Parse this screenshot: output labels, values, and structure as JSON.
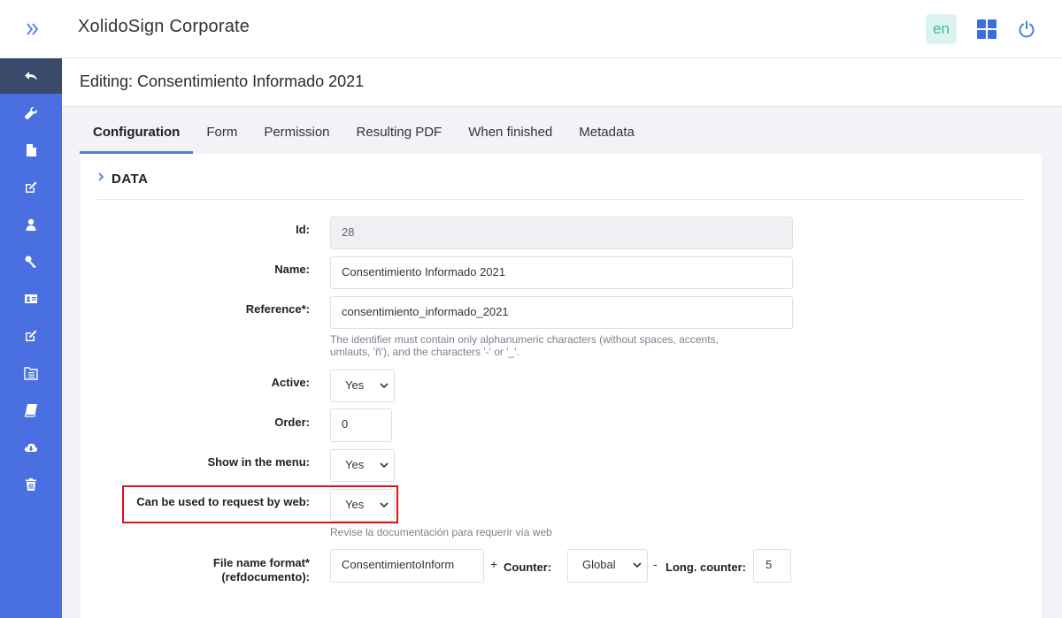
{
  "header": {
    "app_title": "XolidoSign Corporate",
    "lang": "en",
    "expand_icon": "chevron-double-right-icon",
    "apps_icon": "grid-icon",
    "power_icon": "power-icon",
    "accent_color": "#4a6fe0"
  },
  "sidebar": {
    "items": [
      {
        "icon": "back-arrow-icon",
        "active": true
      },
      {
        "icon": "wrench-icon"
      },
      {
        "icon": "document-icon"
      },
      {
        "icon": "edit-icon"
      },
      {
        "icon": "user-icon"
      },
      {
        "icon": "key-icon"
      },
      {
        "icon": "id-card-icon"
      },
      {
        "icon": "edit-alt-icon"
      },
      {
        "icon": "folder-list-icon"
      },
      {
        "icon": "book-icon"
      },
      {
        "icon": "cloud-download-icon"
      },
      {
        "icon": "trash-icon"
      }
    ]
  },
  "page": {
    "title": "Editing: Consentimiento Informado 2021"
  },
  "tabs": [
    {
      "label": "Configuration",
      "active": true
    },
    {
      "label": "Form"
    },
    {
      "label": "Permission"
    },
    {
      "label": "Resulting PDF"
    },
    {
      "label": "When finished"
    },
    {
      "label": "Metadata"
    }
  ],
  "section": {
    "title": "DATA"
  },
  "form": {
    "id": {
      "label": "Id:",
      "value": "28"
    },
    "name": {
      "label": "Name:",
      "value": "Consentimiento Informado 2021"
    },
    "reference": {
      "label": "Reference*:",
      "value": "consentimiento_informado_2021",
      "help_line1": "The identifier must contain only alphanumeric characters (without spaces, accents,",
      "help_line2": "umlauts, 'ñ'), and the characters '-' or '_'."
    },
    "active": {
      "label": "Active:",
      "value": "Yes"
    },
    "order": {
      "label": "Order:",
      "value": "0"
    },
    "show_in_menu": {
      "label": "Show in the menu:",
      "value": "Yes"
    },
    "web_request": {
      "label": "Can be used to request by web:",
      "value": "Yes",
      "help": "Revise la documentación para requerir vía web",
      "highlight_color": "#e0101a"
    },
    "file_name": {
      "label_line1": "File name format*",
      "label_line2": "(refdocumento):",
      "value": "ConsentimientoInform",
      "plus": "+",
      "counter_label": "Counter:",
      "counter_value": "Global",
      "minus": "-",
      "long_counter_label": "Long. counter:",
      "long_counter_value": "5"
    }
  }
}
